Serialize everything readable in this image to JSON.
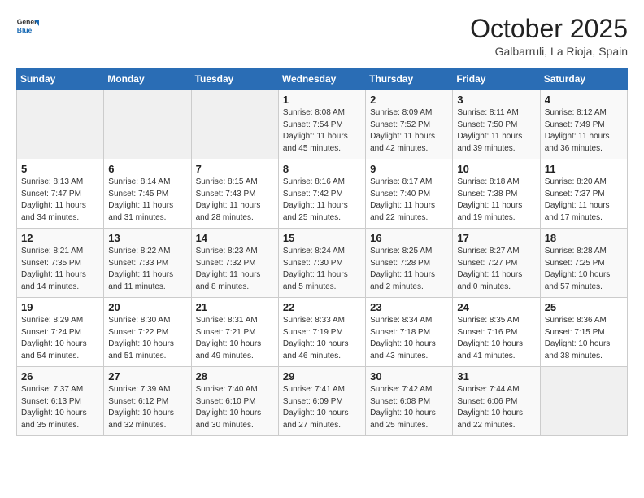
{
  "header": {
    "logo_general": "General",
    "logo_blue": "Blue",
    "month_title": "October 2025",
    "subtitle": "Galbarruli, La Rioja, Spain"
  },
  "days_of_week": [
    "Sunday",
    "Monday",
    "Tuesday",
    "Wednesday",
    "Thursday",
    "Friday",
    "Saturday"
  ],
  "weeks": [
    [
      {
        "day": "",
        "info": ""
      },
      {
        "day": "",
        "info": ""
      },
      {
        "day": "",
        "info": ""
      },
      {
        "day": "1",
        "info": "Sunrise: 8:08 AM\nSunset: 7:54 PM\nDaylight: 11 hours\nand 45 minutes."
      },
      {
        "day": "2",
        "info": "Sunrise: 8:09 AM\nSunset: 7:52 PM\nDaylight: 11 hours\nand 42 minutes."
      },
      {
        "day": "3",
        "info": "Sunrise: 8:11 AM\nSunset: 7:50 PM\nDaylight: 11 hours\nand 39 minutes."
      },
      {
        "day": "4",
        "info": "Sunrise: 8:12 AM\nSunset: 7:49 PM\nDaylight: 11 hours\nand 36 minutes."
      }
    ],
    [
      {
        "day": "5",
        "info": "Sunrise: 8:13 AM\nSunset: 7:47 PM\nDaylight: 11 hours\nand 34 minutes."
      },
      {
        "day": "6",
        "info": "Sunrise: 8:14 AM\nSunset: 7:45 PM\nDaylight: 11 hours\nand 31 minutes."
      },
      {
        "day": "7",
        "info": "Sunrise: 8:15 AM\nSunset: 7:43 PM\nDaylight: 11 hours\nand 28 minutes."
      },
      {
        "day": "8",
        "info": "Sunrise: 8:16 AM\nSunset: 7:42 PM\nDaylight: 11 hours\nand 25 minutes."
      },
      {
        "day": "9",
        "info": "Sunrise: 8:17 AM\nSunset: 7:40 PM\nDaylight: 11 hours\nand 22 minutes."
      },
      {
        "day": "10",
        "info": "Sunrise: 8:18 AM\nSunset: 7:38 PM\nDaylight: 11 hours\nand 19 minutes."
      },
      {
        "day": "11",
        "info": "Sunrise: 8:20 AM\nSunset: 7:37 PM\nDaylight: 11 hours\nand 17 minutes."
      }
    ],
    [
      {
        "day": "12",
        "info": "Sunrise: 8:21 AM\nSunset: 7:35 PM\nDaylight: 11 hours\nand 14 minutes."
      },
      {
        "day": "13",
        "info": "Sunrise: 8:22 AM\nSunset: 7:33 PM\nDaylight: 11 hours\nand 11 minutes."
      },
      {
        "day": "14",
        "info": "Sunrise: 8:23 AM\nSunset: 7:32 PM\nDaylight: 11 hours\nand 8 minutes."
      },
      {
        "day": "15",
        "info": "Sunrise: 8:24 AM\nSunset: 7:30 PM\nDaylight: 11 hours\nand 5 minutes."
      },
      {
        "day": "16",
        "info": "Sunrise: 8:25 AM\nSunset: 7:28 PM\nDaylight: 11 hours\nand 2 minutes."
      },
      {
        "day": "17",
        "info": "Sunrise: 8:27 AM\nSunset: 7:27 PM\nDaylight: 11 hours\nand 0 minutes."
      },
      {
        "day": "18",
        "info": "Sunrise: 8:28 AM\nSunset: 7:25 PM\nDaylight: 10 hours\nand 57 minutes."
      }
    ],
    [
      {
        "day": "19",
        "info": "Sunrise: 8:29 AM\nSunset: 7:24 PM\nDaylight: 10 hours\nand 54 minutes."
      },
      {
        "day": "20",
        "info": "Sunrise: 8:30 AM\nSunset: 7:22 PM\nDaylight: 10 hours\nand 51 minutes."
      },
      {
        "day": "21",
        "info": "Sunrise: 8:31 AM\nSunset: 7:21 PM\nDaylight: 10 hours\nand 49 minutes."
      },
      {
        "day": "22",
        "info": "Sunrise: 8:33 AM\nSunset: 7:19 PM\nDaylight: 10 hours\nand 46 minutes."
      },
      {
        "day": "23",
        "info": "Sunrise: 8:34 AM\nSunset: 7:18 PM\nDaylight: 10 hours\nand 43 minutes."
      },
      {
        "day": "24",
        "info": "Sunrise: 8:35 AM\nSunset: 7:16 PM\nDaylight: 10 hours\nand 41 minutes."
      },
      {
        "day": "25",
        "info": "Sunrise: 8:36 AM\nSunset: 7:15 PM\nDaylight: 10 hours\nand 38 minutes."
      }
    ],
    [
      {
        "day": "26",
        "info": "Sunrise: 7:37 AM\nSunset: 6:13 PM\nDaylight: 10 hours\nand 35 minutes."
      },
      {
        "day": "27",
        "info": "Sunrise: 7:39 AM\nSunset: 6:12 PM\nDaylight: 10 hours\nand 32 minutes."
      },
      {
        "day": "28",
        "info": "Sunrise: 7:40 AM\nSunset: 6:10 PM\nDaylight: 10 hours\nand 30 minutes."
      },
      {
        "day": "29",
        "info": "Sunrise: 7:41 AM\nSunset: 6:09 PM\nDaylight: 10 hours\nand 27 minutes."
      },
      {
        "day": "30",
        "info": "Sunrise: 7:42 AM\nSunset: 6:08 PM\nDaylight: 10 hours\nand 25 minutes."
      },
      {
        "day": "31",
        "info": "Sunrise: 7:44 AM\nSunset: 6:06 PM\nDaylight: 10 hours\nand 22 minutes."
      },
      {
        "day": "",
        "info": ""
      }
    ]
  ]
}
